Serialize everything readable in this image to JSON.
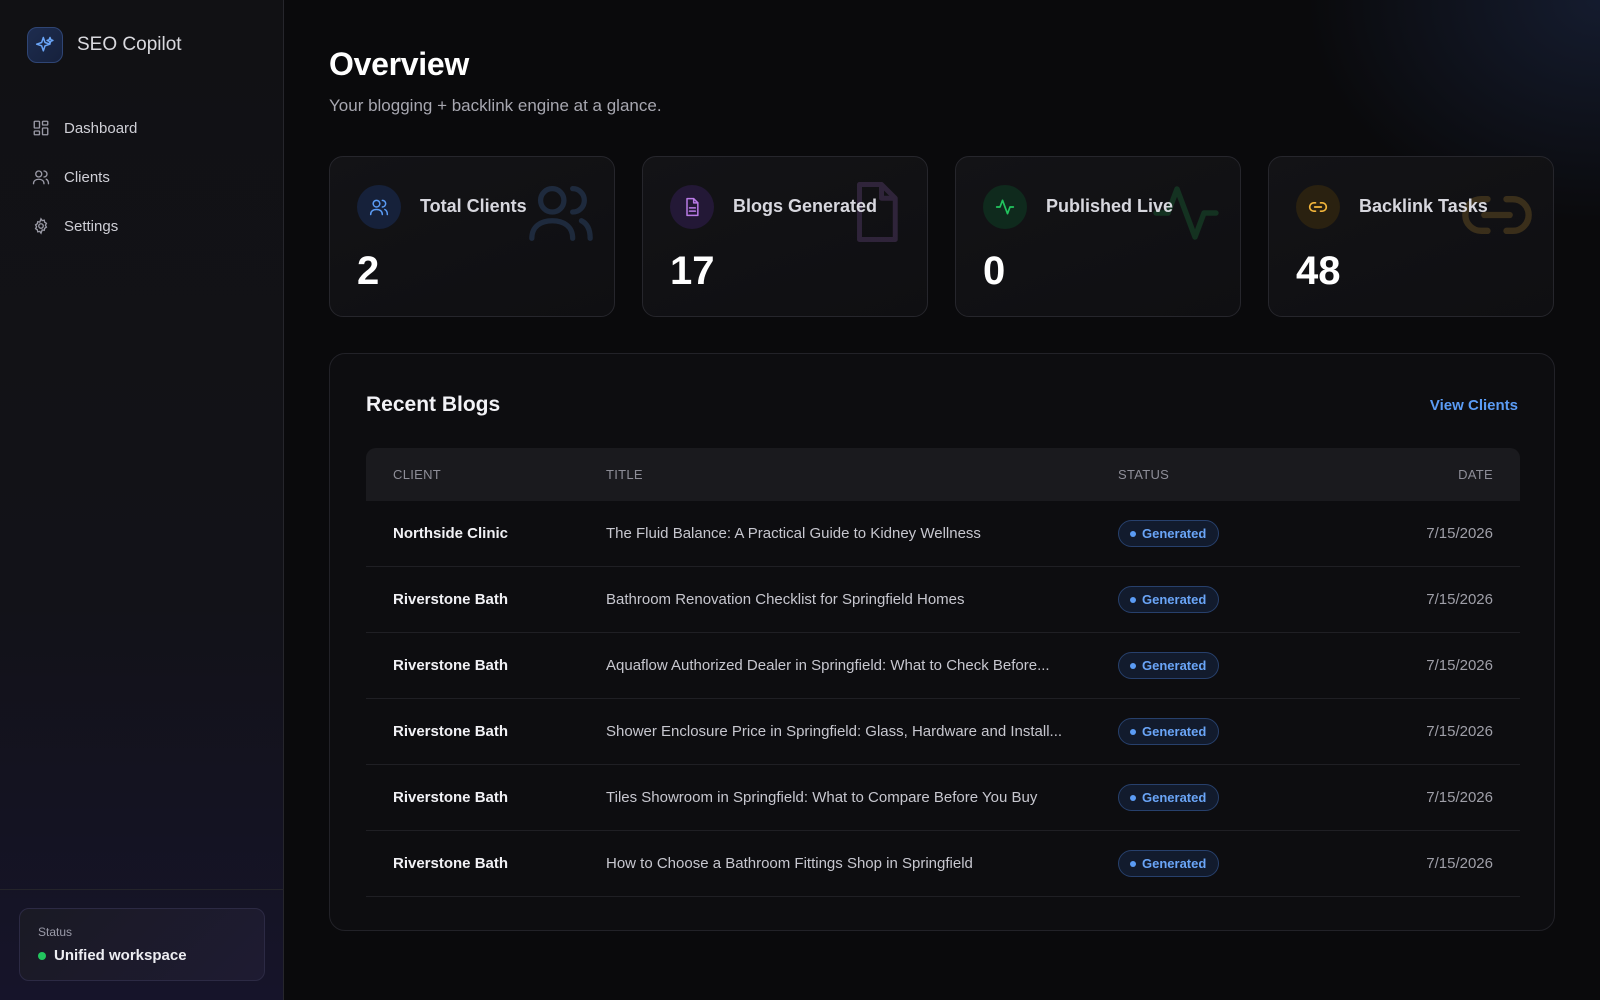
{
  "app": {
    "name": "SEO Copilot"
  },
  "sidebar": {
    "items": [
      {
        "label": "Dashboard",
        "icon": "dashboard-icon"
      },
      {
        "label": "Clients",
        "icon": "users-icon"
      },
      {
        "label": "Settings",
        "icon": "gear-icon"
      }
    ],
    "status": {
      "label": "Status",
      "value": "Unified workspace",
      "color": "#22c55e"
    }
  },
  "page": {
    "title": "Overview",
    "subtitle": "Your blogging + backlink engine at a glance."
  },
  "stats": [
    {
      "label": "Total Clients",
      "value": "2",
      "icon": "users-icon",
      "color": "#5b9cf5"
    },
    {
      "label": "Blogs Generated",
      "value": "17",
      "icon": "document-icon",
      "color": "#b97ae6"
    },
    {
      "label": "Published Live",
      "value": "0",
      "icon": "activity-icon",
      "color": "#22c55e"
    },
    {
      "label": "Backlink Tasks",
      "value": "48",
      "icon": "link-icon",
      "color": "#f5b73b"
    }
  ],
  "recent": {
    "title": "Recent Blogs",
    "view_link": "View Clients",
    "columns": [
      "CLIENT",
      "TITLE",
      "STATUS",
      "DATE"
    ],
    "rows": [
      {
        "client": "Northside Clinic",
        "title": "The Fluid Balance: A Practical Guide to Kidney Wellness",
        "status": "Generated",
        "date": "7/15/2026"
      },
      {
        "client": "Riverstone Bath",
        "title": "Bathroom Renovation Checklist for Springfield Homes",
        "status": "Generated",
        "date": "7/15/2026"
      },
      {
        "client": "Riverstone Bath",
        "title": "Aquaflow Authorized Dealer in Springfield: What to Check Before...",
        "status": "Generated",
        "date": "7/15/2026"
      },
      {
        "client": "Riverstone Bath",
        "title": "Shower Enclosure Price in Springfield: Glass, Hardware and Install...",
        "status": "Generated",
        "date": "7/15/2026"
      },
      {
        "client": "Riverstone Bath",
        "title": "Tiles Showroom in Springfield: What to Compare Before You Buy",
        "status": "Generated",
        "date": "7/15/2026"
      },
      {
        "client": "Riverstone Bath",
        "title": "How to Choose a Bathroom Fittings Shop in Springfield",
        "status": "Generated",
        "date": "7/15/2026"
      }
    ]
  }
}
